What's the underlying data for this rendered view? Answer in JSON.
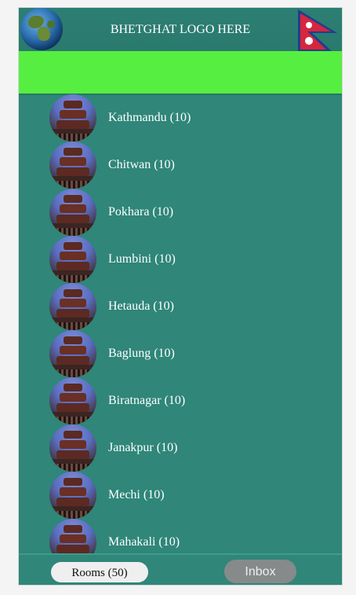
{
  "header": {
    "title": "BHETGHAT LOGO HERE",
    "left_icon": "globe-icon",
    "right_icon": "nepal-flag-icon"
  },
  "banner": {
    "color": "#56ef41"
  },
  "rooms": [
    {
      "label": "Kathmandu (10)"
    },
    {
      "label": "Chitwan (10)"
    },
    {
      "label": "Pokhara (10)"
    },
    {
      "label": "Lumbini (10)"
    },
    {
      "label": "Hetauda (10)"
    },
    {
      "label": "Baglung (10)"
    },
    {
      "label": "Biratnagar (10)"
    },
    {
      "label": "Janakpur (10)"
    },
    {
      "label": "Mechi (10)"
    },
    {
      "label": "Mahakali (10)"
    }
  ],
  "footer": {
    "rooms_label": "Rooms (50)",
    "inbox_label": "Inbox"
  },
  "colors": {
    "background": "#2f8679",
    "banner": "#56ef41",
    "rooms_button": "#efefef",
    "inbox_button": "#878a8a"
  }
}
